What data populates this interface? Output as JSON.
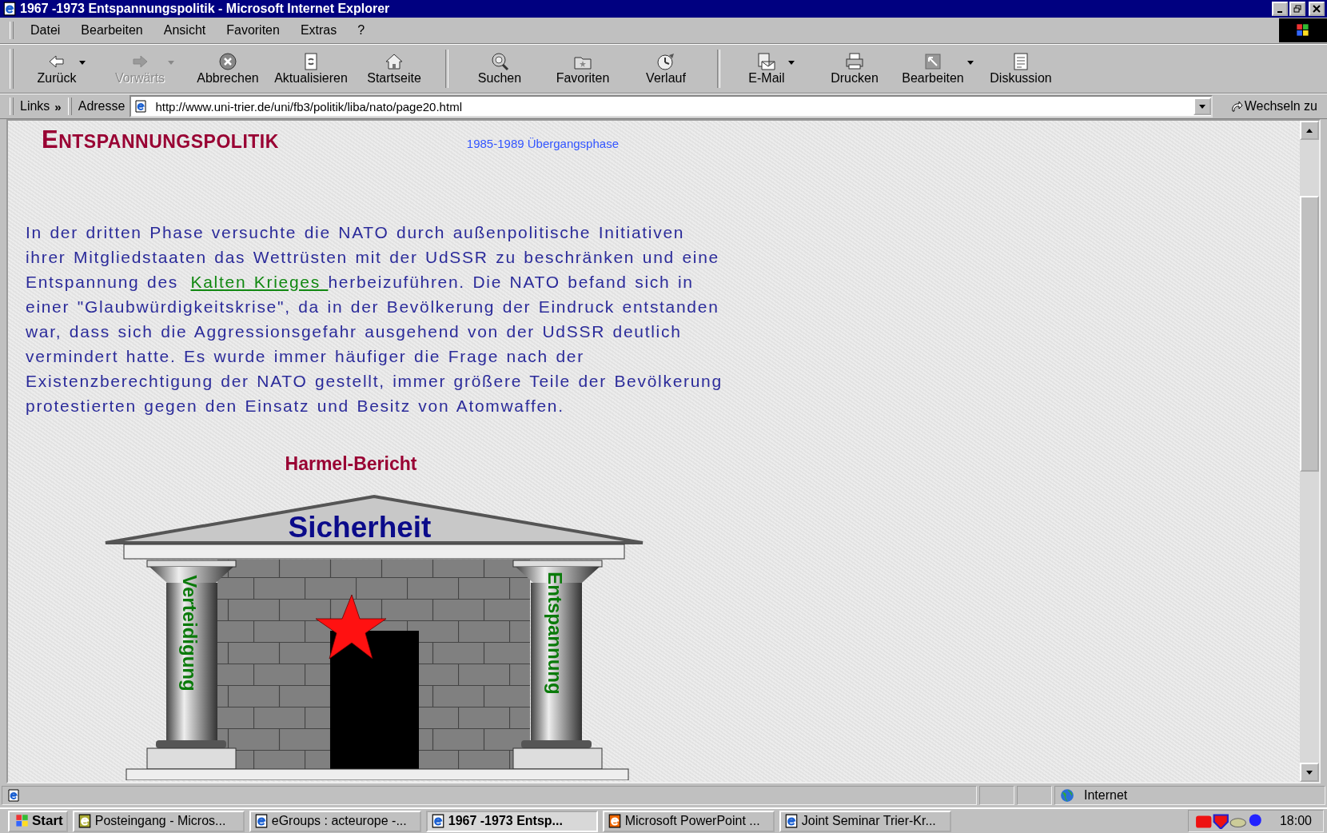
{
  "window": {
    "title": "1967 -1973 Entspannungspolitik - Microsoft Internet Explorer"
  },
  "menu": [
    "Datei",
    "Bearbeiten",
    "Ansicht",
    "Favoriten",
    "Extras",
    "?"
  ],
  "toolbar": [
    {
      "buttons": [
        {
          "label": "Zurück",
          "disabled": false,
          "dropdown": true
        },
        {
          "label": "Vorwärts",
          "disabled": true,
          "dropdown": true
        },
        {
          "label": "Abbrechen",
          "disabled": false,
          "dropdown": false
        },
        {
          "label": "Aktualisieren",
          "disabled": false,
          "dropdown": false
        },
        {
          "label": "Startseite",
          "disabled": false,
          "dropdown": false
        }
      ]
    },
    {
      "buttons": [
        {
          "label": "Suchen",
          "disabled": false,
          "dropdown": false
        },
        {
          "label": "Favoriten",
          "disabled": false,
          "dropdown": false
        },
        {
          "label": "Verlauf",
          "disabled": false,
          "dropdown": false
        }
      ]
    },
    {
      "buttons": [
        {
          "label": "E-Mail",
          "disabled": false,
          "dropdown": true
        },
        {
          "label": "Drucken",
          "disabled": false,
          "dropdown": false
        },
        {
          "label": "Bearbeiten",
          "disabled": false,
          "dropdown": true
        },
        {
          "label": "Diskussion",
          "disabled": false,
          "dropdown": false
        }
      ]
    }
  ],
  "links": {
    "label": "Links",
    "chevron": "»"
  },
  "address": {
    "label": "Adresse",
    "value": "http://www.uni-trier.de/uni/fb3/politik/liba/nato/page20.html",
    "go": "Wechseln zu"
  },
  "page": {
    "heading": "ENTSPANNUNGSPOLITIK",
    "nav_link": "1985-1989 Übergangsphase",
    "paragraph_before": "In der dritten Phase versuchte die NATO durch außenpolitische Initiativen ihrer Mitgliedstaaten das Wettrüsten mit der UdSSR zu beschränken und eine Entspannung des ",
    "paragraph_link": "Kalten Krieges ",
    "paragraph_after": "herbeizuführen. Die NATO befand sich in einer \"Glaubwürdigkeitskrise\", da in der Bevölkerung der Eindruck entstanden war, dass sich die Aggressionsgefahr ausgehend von der UdSSR deutlich vermindert hatte. Es wurde immer häufiger die Frage nach der Existenzberechtigung der NATO gestellt, immer größere Teile der Bevölkerung protestierten gegen den Einsatz und Besitz von Atomwaffen.",
    "diagram": {
      "title": "Harmel-Bericht",
      "roof": "Sicherheit",
      "left_pillar": "Verteidigung",
      "right_pillar": "Entspannung"
    }
  },
  "status_bar": {
    "zone": "Internet"
  },
  "taskbar": {
    "start": "Start",
    "items": [
      {
        "label": "Posteingang - Micros...",
        "selected": false
      },
      {
        "label": "eGroups : acteurope -...",
        "selected": false
      },
      {
        "label": "1967 -1973 Entsp...",
        "selected": true
      },
      {
        "label": "Microsoft PowerPoint ...",
        "selected": false
      },
      {
        "label": "Joint Seminar Trier-Kr...",
        "selected": false
      }
    ],
    "clock": "18:00"
  }
}
